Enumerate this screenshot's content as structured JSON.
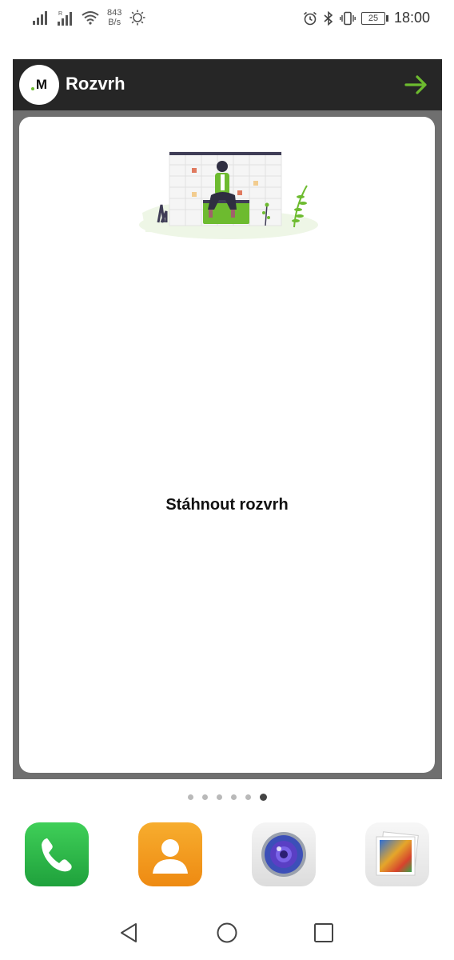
{
  "status_bar": {
    "net_speed_value": "843",
    "net_speed_unit": "B/s",
    "battery_level": "25",
    "time": "18:00",
    "icons": [
      "signal-icon",
      "signal-roaming-icon",
      "wifi-icon",
      "brightness-icon",
      "alarm-icon",
      "bluetooth-icon",
      "vibrate-icon",
      "battery-icon"
    ]
  },
  "widget": {
    "logo_letter": "M",
    "title": "Rozvrh",
    "open_icon": "arrow-right-icon",
    "accent_color": "#6dbb2f",
    "cta_label": "Stáhnout rozvrh"
  },
  "pager": {
    "count": 6,
    "active_index": 5
  },
  "dock": {
    "apps": [
      {
        "name": "phone-app",
        "icon": "phone-icon"
      },
      {
        "name": "contacts-app",
        "icon": "contacts-icon"
      },
      {
        "name": "camera-app",
        "icon": "camera-icon"
      },
      {
        "name": "gallery-app",
        "icon": "gallery-icon"
      }
    ]
  },
  "nav": {
    "buttons": [
      "back-icon",
      "home-icon",
      "recents-icon"
    ]
  }
}
